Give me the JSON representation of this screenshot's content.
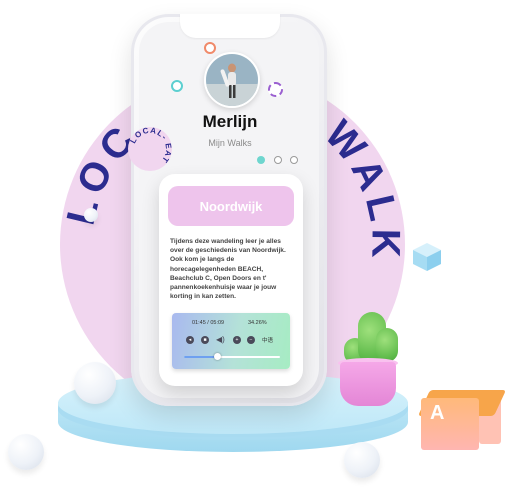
{
  "profile": {
    "name": "Merlijn",
    "subtitle": "Mijn Walks"
  },
  "badge": {
    "ring_text": "LOCAL-EAT-WALK",
    "sticker_text": "LOCAL- EAT"
  },
  "card": {
    "title": "Noordwijk",
    "description": "Tijdens deze wandeling leer je alles over de geschiedenis van Noordwijk. Ook kom je langs de horecagelegenheden BEACH, Beachclub C, Open Doors en t' pannenkoekenhuisje waar je jouw korting in kan zetten."
  },
  "player": {
    "time": "01:45 / 05:09",
    "percent": "34.26%",
    "progress": 0.3426,
    "language": "中语"
  },
  "block": {
    "letter": "A"
  },
  "colors": {
    "badge_bg": "#f1d6ef",
    "ring_text": "#2c2c8f",
    "card_header": "#eec4ec",
    "pagination_active": "#6fd6cf"
  }
}
